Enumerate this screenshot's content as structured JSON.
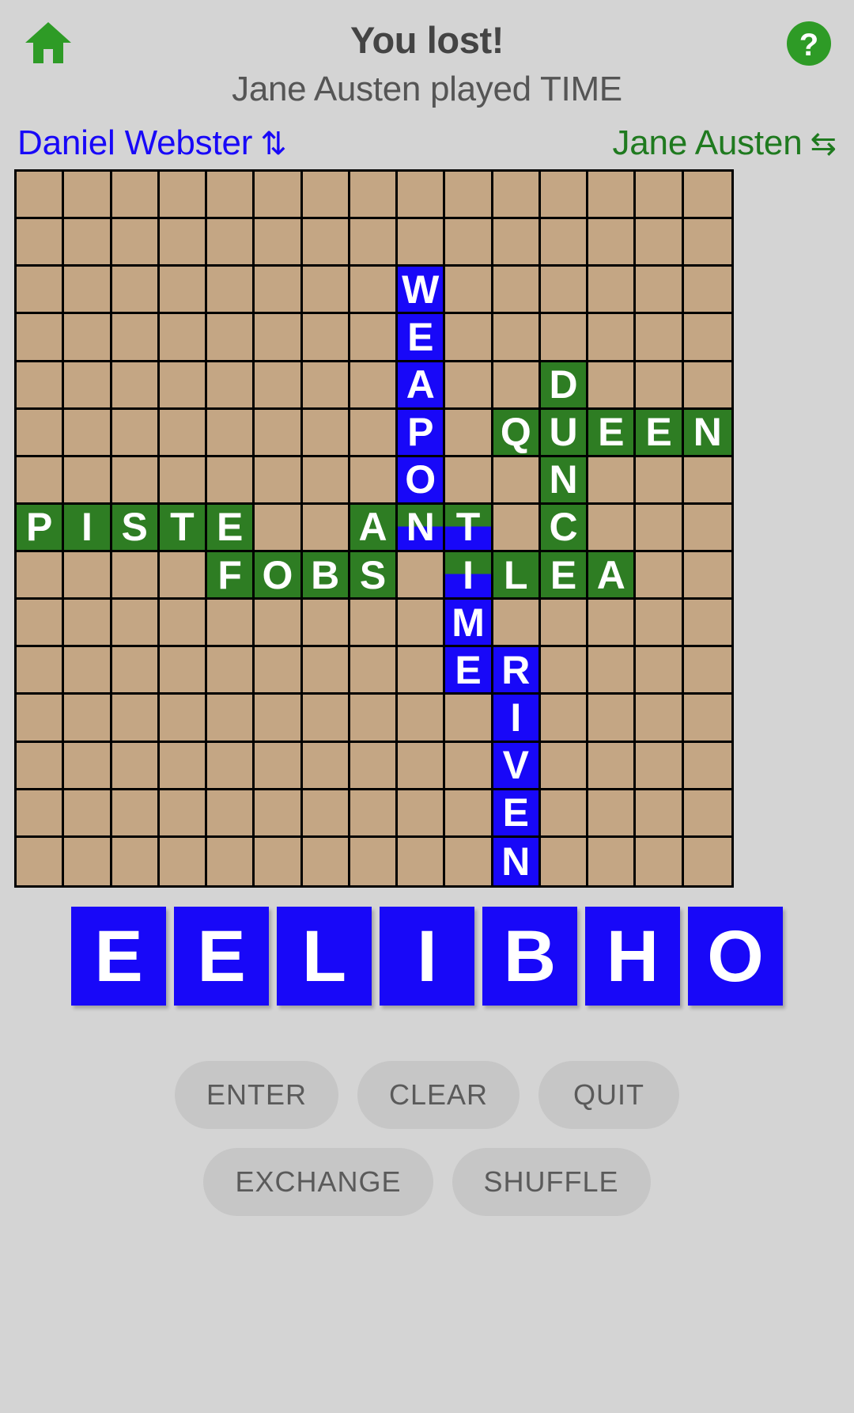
{
  "header": {
    "home_icon": "home-icon",
    "help_icon": "question-mark-icon",
    "title": "You lost!",
    "subtitle": "Jane Austen played TIME"
  },
  "players": {
    "left": {
      "name": "Daniel Webster",
      "direction_icon": "⇅",
      "color": "#1808f8"
    },
    "right": {
      "name": "Jane Austen",
      "direction_icon": "⇆",
      "color": "#1f7a1f"
    }
  },
  "board": {
    "rows": 15,
    "cols": 15,
    "empty_color": "#c4a684",
    "player1_color": "#1808f8",
    "player2_color": "#2e7d23",
    "tiles": [
      {
        "row": 2,
        "col": 8,
        "letter": "W",
        "owner": "blue"
      },
      {
        "row": 3,
        "col": 8,
        "letter": "E",
        "owner": "blue"
      },
      {
        "row": 4,
        "col": 8,
        "letter": "A",
        "owner": "blue"
      },
      {
        "row": 4,
        "col": 11,
        "letter": "D",
        "owner": "green"
      },
      {
        "row": 5,
        "col": 8,
        "letter": "P",
        "owner": "blue"
      },
      {
        "row": 5,
        "col": 10,
        "letter": "Q",
        "owner": "green"
      },
      {
        "row": 5,
        "col": 11,
        "letter": "U",
        "owner": "green"
      },
      {
        "row": 5,
        "col": 12,
        "letter": "E",
        "owner": "green"
      },
      {
        "row": 5,
        "col": 13,
        "letter": "E",
        "owner": "green"
      },
      {
        "row": 5,
        "col": 14,
        "letter": "N",
        "owner": "green"
      },
      {
        "row": 6,
        "col": 8,
        "letter": "O",
        "owner": "blue"
      },
      {
        "row": 6,
        "col": 11,
        "letter": "N",
        "owner": "green"
      },
      {
        "row": 7,
        "col": 0,
        "letter": "P",
        "owner": "green"
      },
      {
        "row": 7,
        "col": 1,
        "letter": "I",
        "owner": "green"
      },
      {
        "row": 7,
        "col": 2,
        "letter": "S",
        "owner": "green"
      },
      {
        "row": 7,
        "col": 3,
        "letter": "T",
        "owner": "green"
      },
      {
        "row": 7,
        "col": 4,
        "letter": "E",
        "owner": "green"
      },
      {
        "row": 7,
        "col": 7,
        "letter": "A",
        "owner": "green"
      },
      {
        "row": 7,
        "col": 8,
        "letter": "N",
        "owner": "split"
      },
      {
        "row": 7,
        "col": 9,
        "letter": "T",
        "owner": "split"
      },
      {
        "row": 7,
        "col": 11,
        "letter": "C",
        "owner": "green"
      },
      {
        "row": 8,
        "col": 4,
        "letter": "F",
        "owner": "green"
      },
      {
        "row": 8,
        "col": 5,
        "letter": "O",
        "owner": "green"
      },
      {
        "row": 8,
        "col": 6,
        "letter": "B",
        "owner": "green"
      },
      {
        "row": 8,
        "col": 7,
        "letter": "S",
        "owner": "green"
      },
      {
        "row": 8,
        "col": 9,
        "letter": "I",
        "owner": "split"
      },
      {
        "row": 8,
        "col": 10,
        "letter": "L",
        "owner": "green"
      },
      {
        "row": 8,
        "col": 11,
        "letter": "E",
        "owner": "green"
      },
      {
        "row": 8,
        "col": 12,
        "letter": "A",
        "owner": "green"
      },
      {
        "row": 9,
        "col": 9,
        "letter": "M",
        "owner": "blue"
      },
      {
        "row": 10,
        "col": 9,
        "letter": "E",
        "owner": "blue"
      },
      {
        "row": 10,
        "col": 10,
        "letter": "R",
        "owner": "blue"
      },
      {
        "row": 11,
        "col": 10,
        "letter": "I",
        "owner": "blue"
      },
      {
        "row": 12,
        "col": 10,
        "letter": "V",
        "owner": "blue"
      },
      {
        "row": 13,
        "col": 10,
        "letter": "E",
        "owner": "blue"
      },
      {
        "row": 14,
        "col": 10,
        "letter": "N",
        "owner": "blue"
      }
    ]
  },
  "rack": {
    "tiles": [
      "E",
      "E",
      "L",
      "I",
      "B",
      "H",
      "O"
    ],
    "tile_color": "#1808f8"
  },
  "buttons": {
    "row1": [
      "ENTER",
      "CLEAR",
      "QUIT"
    ],
    "row2": [
      "EXCHANGE",
      "SHUFFLE"
    ]
  }
}
